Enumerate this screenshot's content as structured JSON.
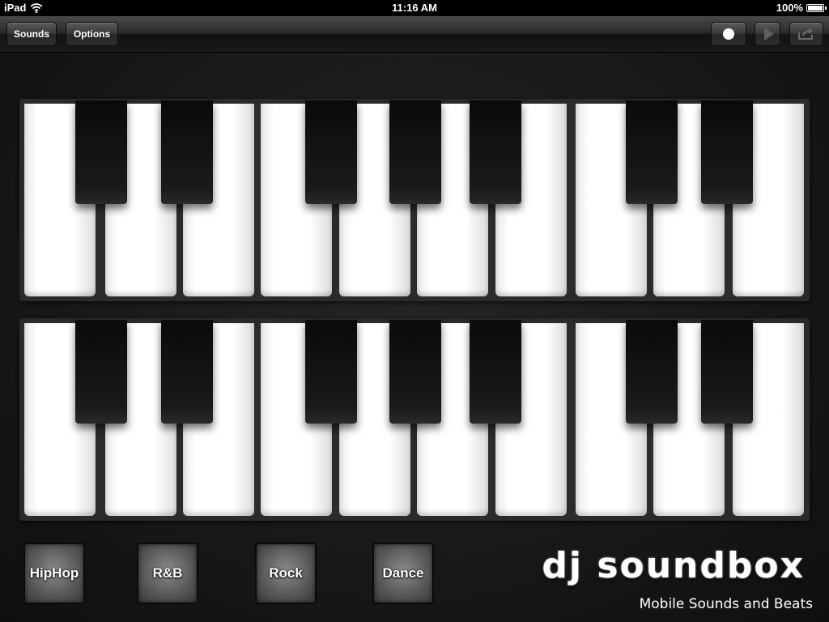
{
  "status_bar": {
    "device": "iPad",
    "time": "11:16 AM",
    "battery": "100%"
  },
  "toolbar": {
    "sounds_label": "Sounds",
    "options_label": "Options"
  },
  "keyboards": [
    {
      "name": "upper",
      "white_keys": 10,
      "black_keys": 7
    },
    {
      "name": "lower",
      "white_keys": 10,
      "black_keys": 7
    }
  ],
  "genres": [
    {
      "id": "hiphop",
      "label": "HipHop"
    },
    {
      "id": "rnb",
      "label": "R&B"
    },
    {
      "id": "rock",
      "label": "Rock"
    },
    {
      "id": "dance",
      "label": "Dance"
    }
  ],
  "branding": {
    "logo": "dj soundbox",
    "tagline": "Mobile Sounds and Beats"
  },
  "icons": {
    "wifi": "wifi-icon",
    "battery": "battery-icon",
    "record": "record-icon",
    "play": "play-icon",
    "share": "share-icon"
  },
  "colors": {
    "background": "#141414",
    "white_key": "#ffffff",
    "black_key": "#111111"
  }
}
